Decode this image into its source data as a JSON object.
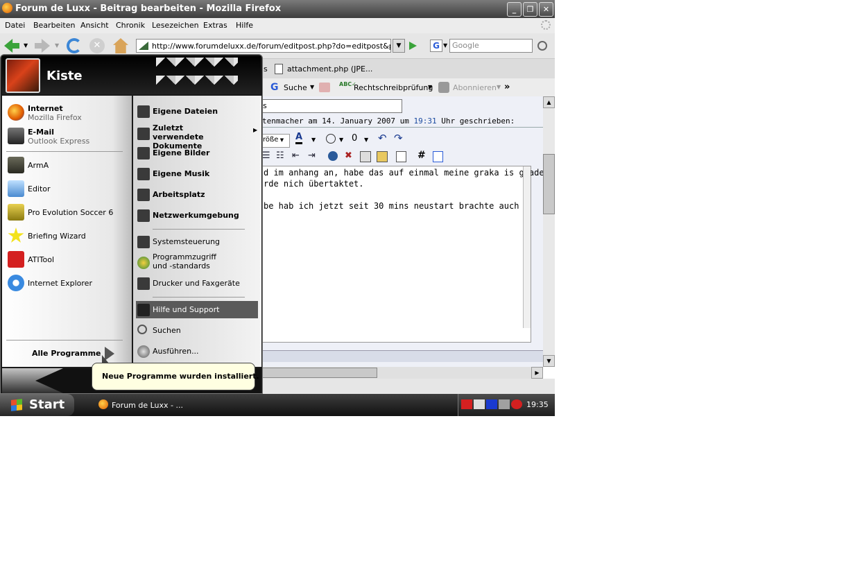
{
  "window": {
    "title": "Forum de Luxx - Beitrag bearbeiten - Mozilla Firefox",
    "controls": {
      "minimize": "_",
      "restore": "❐",
      "close": "✕"
    }
  },
  "menubar": [
    "Datei",
    "Bearbeiten",
    "Ansicht",
    "Chronik",
    "Lesezeichen",
    "Extras",
    "Hilfe"
  ],
  "navbar": {
    "url": "http://www.forumdeluxx.de/forum/editpost.php?do=editpost&postid=",
    "search_placeholder": "Google",
    "search_engine": "G"
  },
  "tabs": [
    "s",
    "attachment.php (JPE..."
  ],
  "toolbar": {
    "search_label": "Suche",
    "spellcheck_label": "Rechtschreibprüfung",
    "subscribe_label": "Abonnieren",
    "more": "»"
  },
  "editor": {
    "title_value": "s",
    "quote_prefix": "tenmacher am 14. January 2007 um",
    "quote_time": "19:31",
    "quote_suffix": "Uhr geschrieben:",
    "font_size_label": "röße",
    "lines": [
      "d im anhang an, habe das auf einmal meine graka is grade",
      "rde nich übertaktet.",
      "",
      "be hab ich jetzt seit 30 mins neustart brachte auch"
    ]
  },
  "startmenu": {
    "user": "Kiste",
    "pinned": [
      {
        "title": "Internet",
        "subtitle": "Mozilla Firefox",
        "icon": "firefox-icon"
      },
      {
        "title": "E-Mail",
        "subtitle": "Outlook Express",
        "icon": "mail-icon"
      }
    ],
    "recent": [
      {
        "label": "ArmA",
        "icon": "arma-icon"
      },
      {
        "label": "Editor",
        "icon": "notepad-icon"
      },
      {
        "label": "Pro Evolution Soccer 6",
        "icon": "pes-icon"
      },
      {
        "label": "Briefing Wizard",
        "icon": "star-icon"
      },
      {
        "label": "ATITool",
        "icon": "atitool-icon"
      },
      {
        "label": "Internet Explorer",
        "icon": "ie-icon"
      }
    ],
    "all_programs": "Alle Programme",
    "right_bold": [
      "Eigene Dateien",
      "Zuletzt verwendete Dokumente",
      "Eigene Bilder",
      "Eigene Musik",
      "Arbeitsplatz",
      "Netzwerkumgebung"
    ],
    "right_normal": [
      "Systemsteuerung",
      "Programmzugriff und -standards",
      "Drucker und Faxgeräte"
    ],
    "right_bottom": [
      "Hilfe und Support",
      "Suchen",
      "Ausführen..."
    ],
    "balloon": "Neue Programme wurden installiert."
  },
  "taskbar": {
    "start": "Start",
    "task": "Forum de Luxx - ...",
    "clock": "19:35"
  }
}
